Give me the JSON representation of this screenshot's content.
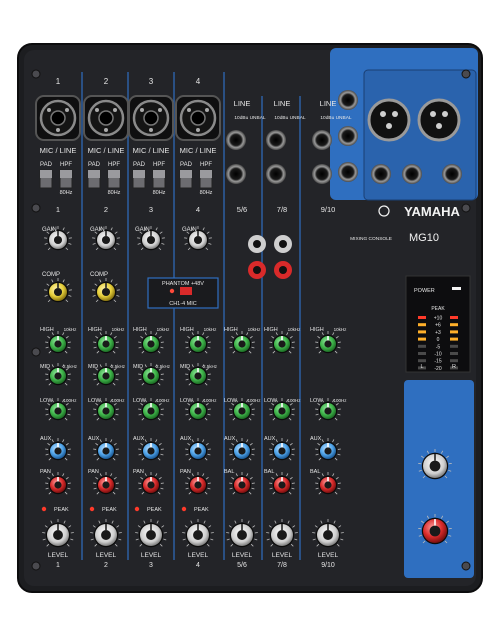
{
  "brand": {
    "name": "YAMAHA",
    "console_label": "MIXING CONSOLE",
    "model": "MG10"
  },
  "meter": {
    "power_label": "POWER",
    "peak_label": "PEAK",
    "levels": [
      "+10",
      "+6",
      "+3",
      "0",
      "-5",
      "-10",
      "-15",
      "-20"
    ],
    "lr": [
      "L",
      "R"
    ]
  },
  "phantom": {
    "label": "PHANTOM +48V",
    "sub": "CH1-4 MIC"
  },
  "mono_channels": [
    {
      "number": "1",
      "input": "MIC / LINE",
      "pad": "PAD",
      "hpf": "HPF",
      "hz": "80Hz",
      "level": "1"
    },
    {
      "number": "2",
      "input": "MIC / LINE",
      "pad": "PAD",
      "hpf": "HPF",
      "hz": "80Hz",
      "level": "2"
    },
    {
      "number": "3",
      "input": "MIC / LINE",
      "pad": "PAD",
      "hpf": "HPF",
      "hz": "80Hz",
      "level": "3"
    },
    {
      "number": "4",
      "input": "MIC / LINE",
      "pad": "PAD",
      "hpf": "HPF",
      "hz": "80Hz",
      "level": "4"
    }
  ],
  "stereo_channels": [
    {
      "label": "5/6",
      "input": "LINE",
      "unbal": "10dBu UNBAL",
      "level": "5/6"
    },
    {
      "label": "7/8",
      "input": "LINE",
      "unbal": "10dBu UNBAL",
      "level": "7/8"
    },
    {
      "label": "9/10",
      "input": "LINE",
      "unbal": "10dBu UNBAL",
      "level": "9/10"
    }
  ],
  "knob_labels": {
    "gain": "GAIN",
    "comp": "COMP",
    "high": "HIGH",
    "mid": "MID",
    "low": "LOW",
    "aux": "AUX",
    "pan": "PAN",
    "bal": "BAL",
    "peak": "PEAK",
    "level": "LEVEL",
    "high_freq": "10kHz",
    "mid_freq": "2.5kHz",
    "low_freq": "100Hz"
  },
  "colors": {
    "panel": "#1c1d20",
    "blue_panel": "#2f6fc0",
    "eq_knob": "#3fb54a",
    "aux_knob": "#4fa3e8",
    "pan_knob": "#d92a2a",
    "level_knob": "#f2f2f2",
    "comp_knob": "#e6cf3a"
  }
}
